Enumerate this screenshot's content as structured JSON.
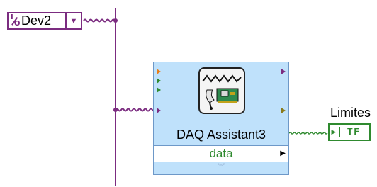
{
  "io_constant": {
    "value": "Dev2",
    "icon": "io-name-icon",
    "color": "#7b2c80"
  },
  "express_vi": {
    "name": "DAQ Assistant3",
    "output_label": "data",
    "icon": "daq-assistant-icon",
    "background": "#bfe1fb"
  },
  "indicator": {
    "label": "Limites",
    "value": "TF",
    "icon": "boolean-indicator-icon",
    "color": "#2f8a2f"
  },
  "colors": {
    "wire_purple": "#7b2c80",
    "wire_green": "#2f8a2f"
  }
}
